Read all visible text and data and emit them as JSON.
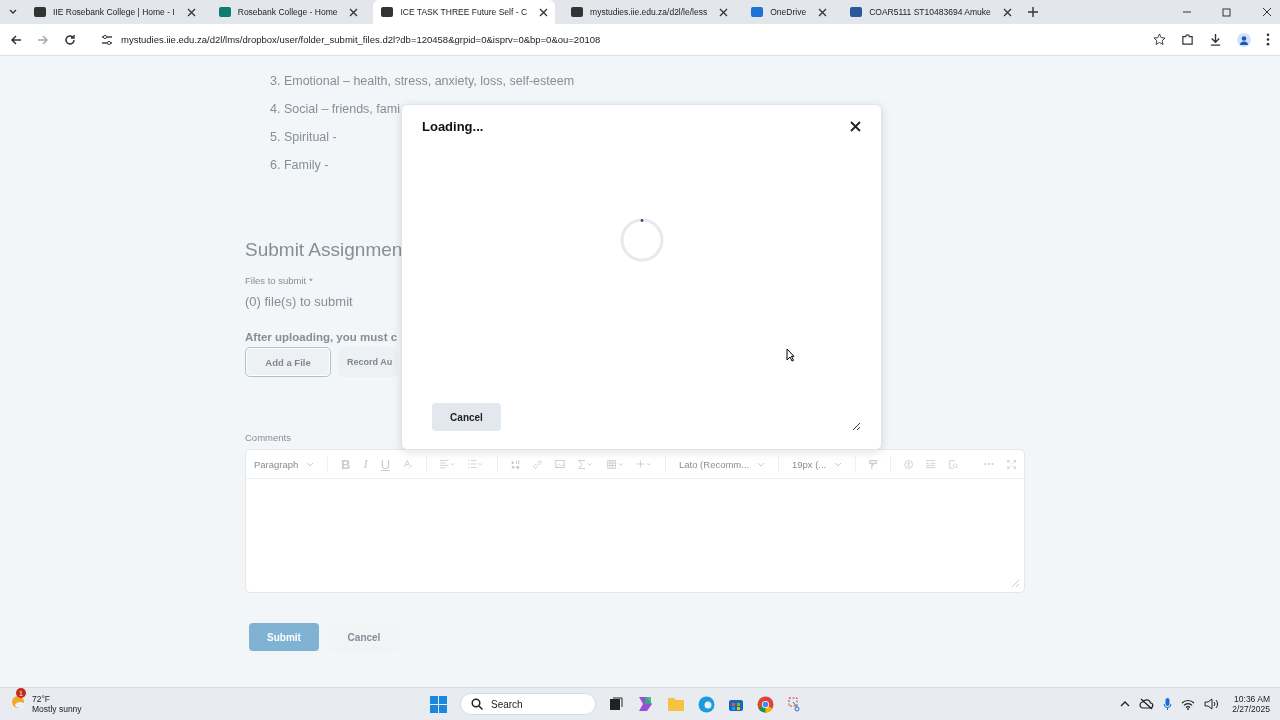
{
  "browser": {
    "tabs": [
      {
        "title": "IIE Rosebank College | Home - I",
        "selected": false
      },
      {
        "title": "Rosebank College - Home",
        "selected": false
      },
      {
        "title": "ICE TASK THREE Future Self - C",
        "selected": true
      },
      {
        "title": "mystudies.iie.edu.za/d2l/le/less",
        "selected": false
      },
      {
        "title": "OneDrive",
        "selected": false
      },
      {
        "title": "COAR5111 ST10483694 Amuke",
        "selected": false
      }
    ],
    "url": "mystudies.iie.edu.za/d2l/lms/dropbox/user/folder_submit_files.d2l?db=120458&grpid=0&isprv=0&bp=0&ou=20108"
  },
  "page": {
    "list_items": [
      "3. Emotional – health, stress, anxiety, loss, self-esteem",
      "4. Social – friends, fami",
      "5. Spiritual -",
      "6. Family -"
    ],
    "heading": "Submit Assignmen",
    "files_label": "Files to submit *",
    "files_count": "(0) file(s) to submit",
    "upload_note": "After uploading, you must c",
    "upload_buttons": [
      {
        "label": "Add a File",
        "selected": true
      },
      {
        "label": "Record Au",
        "selected": false
      }
    ],
    "comments_label": "Comments",
    "editor": {
      "format_select": "Paragraph",
      "format_letters": [
        "B",
        "I",
        "U"
      ],
      "font_select": "Lato (Recomm...",
      "size_select": "19px (..."
    },
    "actions": [
      {
        "label": "Submit",
        "kind": "primary"
      },
      {
        "label": "Cancel",
        "kind": "secondary"
      }
    ]
  },
  "dialog": {
    "title": "Loading...",
    "cancel": "Cancel"
  },
  "taskbar": {
    "weather_badge": "1",
    "temperature": "72°F",
    "condition": "Mostly sunny",
    "search_placeholder": "Search",
    "time": "10:36 AM",
    "date": "2/27/2025"
  }
}
